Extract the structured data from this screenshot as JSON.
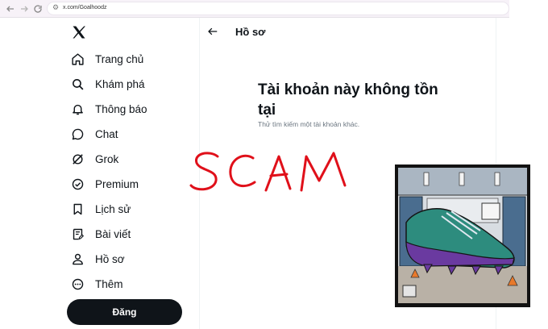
{
  "browser": {
    "url": "x.com/Goalhoodz",
    "back_icon": "arrow-left-icon",
    "forward_icon": "arrow-right-icon",
    "reload_icon": "reload-icon"
  },
  "sidebar": {
    "logo": "x-logo",
    "items": [
      {
        "label": "Trang chủ",
        "icon": "home-icon"
      },
      {
        "label": "Khám phá",
        "icon": "search-icon"
      },
      {
        "label": "Thông báo",
        "icon": "bell-icon"
      },
      {
        "label": "Chat",
        "icon": "chat-icon"
      },
      {
        "label": "Grok",
        "icon": "grok-icon"
      },
      {
        "label": "Premium",
        "icon": "verified-icon"
      },
      {
        "label": "Lịch sử",
        "icon": "bookmark-icon"
      },
      {
        "label": "Bài viết",
        "icon": "article-icon"
      },
      {
        "label": "Hồ sơ",
        "icon": "person-icon"
      },
      {
        "label": "Thêm",
        "icon": "more-icon"
      }
    ],
    "post_label": "Đăng"
  },
  "main": {
    "header_title": "Hồ sơ",
    "title": "Tài khoản này không tồn tại",
    "subtitle": "Thử tìm kiếm một tài khoản khác."
  },
  "annotation": {
    "text": "SCAM",
    "color": "#e0101a"
  },
  "colors": {
    "text": "#0f1419",
    "muted": "#6b7680",
    "post_button": "#0f1419",
    "chrome_bg": "#f7f2f8"
  }
}
